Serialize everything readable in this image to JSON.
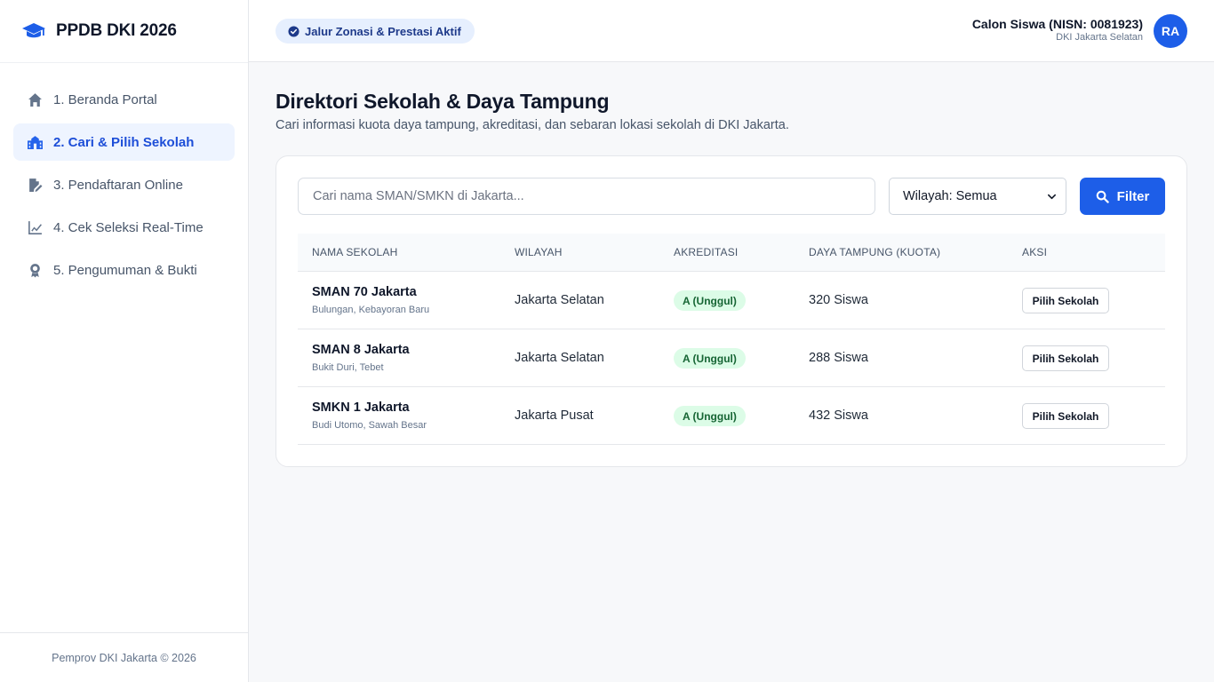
{
  "brand": {
    "title": "PPDB DKI 2026",
    "icon": "graduation-cap-icon"
  },
  "sidebar": {
    "items": [
      {
        "label": "1. Beranda Portal",
        "icon": "home-icon",
        "active": false
      },
      {
        "label": "2. Cari & Pilih Sekolah",
        "icon": "school-icon",
        "active": true
      },
      {
        "label": "3. Pendaftaran Online",
        "icon": "file-edit-icon",
        "active": false
      },
      {
        "label": "4. Cek Seleksi Real-Time",
        "icon": "chart-line-icon",
        "active": false
      },
      {
        "label": "5. Pengumuman & Bukti",
        "icon": "award-icon",
        "active": false
      }
    ],
    "footer": "Pemprov DKI Jakarta © 2026"
  },
  "header": {
    "status_pill": "Jalur Zonasi & Prestasi Aktif",
    "user_name": "Calon Siswa (NISN: 0081923)",
    "user_region": "DKI Jakarta Selatan",
    "avatar_initials": "RA"
  },
  "main": {
    "title": "Direktori Sekolah & Daya Tampung",
    "subtitle": "Cari informasi kuota daya tampung, akreditasi, dan sebaran lokasi sekolah di DKI Jakarta.",
    "search_placeholder": "Cari nama SMAN/SMKN di Jakarta...",
    "region_select": "Wilayah: Semua",
    "filter_label": "Filter",
    "table": {
      "headers": [
        "NAMA SEKOLAH",
        "WILAYAH",
        "AKREDITASI",
        "DAYA TAMPUNG (KUOTA)",
        "AKSI"
      ],
      "rows": [
        {
          "name": "SMAN 70 Jakarta",
          "location": "Bulungan, Kebayoran Baru",
          "region": "Jakarta Selatan",
          "accreditation": "A (Unggul)",
          "capacity": "320 Siswa",
          "action": "Pilih Sekolah"
        },
        {
          "name": "SMAN 8 Jakarta",
          "location": "Bukit Duri, Tebet",
          "region": "Jakarta Selatan",
          "accreditation": "A (Unggul)",
          "capacity": "288 Siswa",
          "action": "Pilih Sekolah"
        },
        {
          "name": "SMKN 1 Jakarta",
          "location": "Budi Utomo, Sawah Besar",
          "region": "Jakarta Pusat",
          "accreditation": "A (Unggul)",
          "capacity": "432 Siswa",
          "action": "Pilih Sekolah"
        }
      ]
    }
  },
  "colors": {
    "accent": "#1d5ee8",
    "active_bg": "#eef4ff",
    "badge_bg": "#dcfce7",
    "badge_text": "#166534"
  }
}
